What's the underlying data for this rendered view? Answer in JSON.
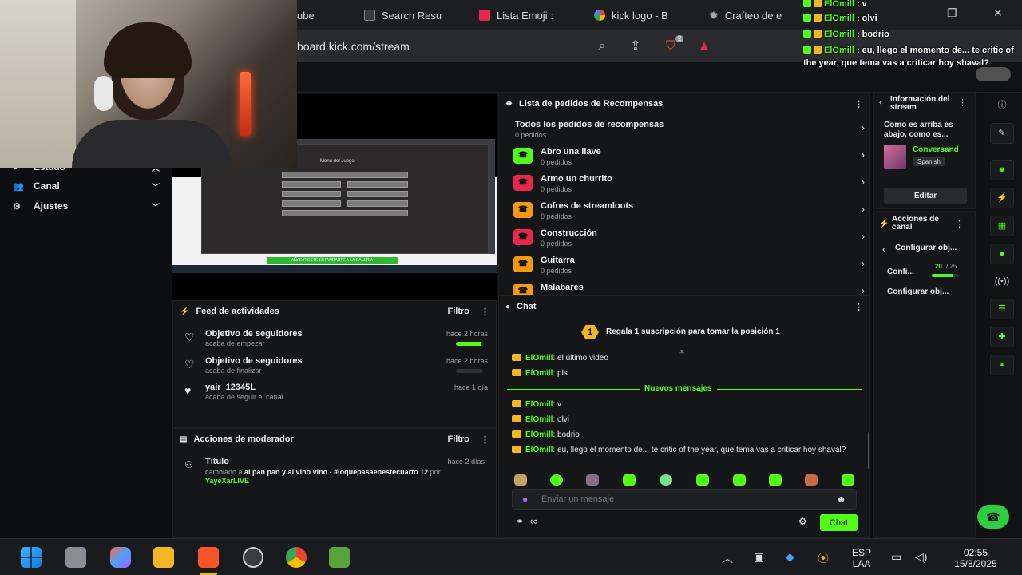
{
  "browser": {
    "tabs": [
      {
        "label": "ube"
      },
      {
        "label": "Search Resu"
      },
      {
        "label": "Lista Emoji :"
      },
      {
        "label": "kick logo - B"
      },
      {
        "label": "Crafteo de e"
      }
    ],
    "url": "board.kick.com/stream",
    "brave_badge": "2"
  },
  "leftnav": {
    "items": [
      {
        "label": "Estado"
      },
      {
        "label": "Canal"
      },
      {
        "label": "Ajustes"
      }
    ]
  },
  "preview": {
    "menu_title": "Menú del Juego",
    "green_banner": "AÑADIR ESTE ESTANDARTE A LA GALERÍA"
  },
  "feed": {
    "title": "Feed de actividades",
    "filter": "Filtro",
    "items": [
      {
        "title": "Objetivo de seguidores",
        "sub": "acaba de empezar",
        "when": "hace 2 horas",
        "progress": 0.9
      },
      {
        "title": "Objetivo de seguidores",
        "sub": "acaba de finalizar",
        "when": "hace 2 horas",
        "progress": 0
      },
      {
        "title": "yair_12345L",
        "sub": "acaba de seguir el canal",
        "when": "hace 1 día"
      }
    ]
  },
  "mod": {
    "title": "Acciones de moderador",
    "filter": "Filtro",
    "item_title": "Título",
    "item_when": "hace 2 días",
    "item_text_prefix": "cambiado a",
    "item_text_value": "al pan pan y al vino vino - #loquepasaenestecuarto 12",
    "item_text_por": "por",
    "item_user": "YayeXarLIVE"
  },
  "rewards": {
    "title": "Lista de pedidos de Recompensas",
    "all_title": "Todos los pedidos de recompensas",
    "all_sub": "0 pedidos",
    "items": [
      {
        "title": "Abro una llave",
        "sub": "0 pedidos",
        "color": "#53fc18"
      },
      {
        "title": "Armo un churrito",
        "sub": "0 pedidos",
        "color": "#e8274b"
      },
      {
        "title": "Cofres de streamloots",
        "sub": "0 pedidos",
        "color": "#f59a0c"
      },
      {
        "title": "Construcción",
        "sub": "0 pedidos",
        "color": "#e8274b"
      },
      {
        "title": "Guitarra",
        "sub": "0 pedidos",
        "color": "#f59a0c"
      },
      {
        "title": "Malabares",
        "sub": "",
        "color": "#f59a0c"
      }
    ]
  },
  "chat": {
    "title": "Chat",
    "pinned_rank": "1",
    "pinned_text": "Regala 1 suscripción para tomar la posición 1",
    "new_messages": "Nuevos mensajes",
    "old_messages": [
      {
        "user": "ElOmill",
        "text": ": el último video"
      },
      {
        "user": "ElOmill",
        "text": ": pls"
      }
    ],
    "messages": [
      {
        "user": "ElOmill",
        "text": ": v"
      },
      {
        "user": "ElOmill",
        "text": ": olvi"
      },
      {
        "user": "ElOmill",
        "text": ": bodrio"
      },
      {
        "user": "ElOmill",
        "text": ": eu, llego el momento de... te critic of the year, que tema vas a criticar hoy shaval?"
      }
    ],
    "input_placeholder": "Enviar un mensaje",
    "send_label": "Chat"
  },
  "stream_info": {
    "title": "Información del stream",
    "description": "Como es arriba es abajo, como es...",
    "category": "Conversand",
    "language": "Spanish",
    "edit_label": "Editar"
  },
  "channel_actions": {
    "title": "Acciones de canal",
    "back_label": "Configurar obj...",
    "goal_label": "Confi...",
    "goal_current": "20",
    "goal_total": "/ 25",
    "goal_progress": 0.8,
    "configure_label": "Configurar obj..."
  },
  "overlay_chat": [
    {
      "user": "ElOmill",
      "text": " : v"
    },
    {
      "user": "ElOmill",
      "text": " : olvi"
    },
    {
      "user": "ElOmill",
      "text": " : bodrio"
    },
    {
      "user": "ElOmill",
      "text": " : eu, llego el momento de... te critic of the year, que tema vas a criticar hoy shaval?"
    }
  ],
  "taskbar": {
    "lang_line1": "ESP",
    "lang_line2": "LAA",
    "time": "02:55",
    "date": "15/8/2025"
  },
  "colors": {
    "kick_green": "#53fc18",
    "panel_bg": "#151617",
    "crown": "#f2b624"
  }
}
